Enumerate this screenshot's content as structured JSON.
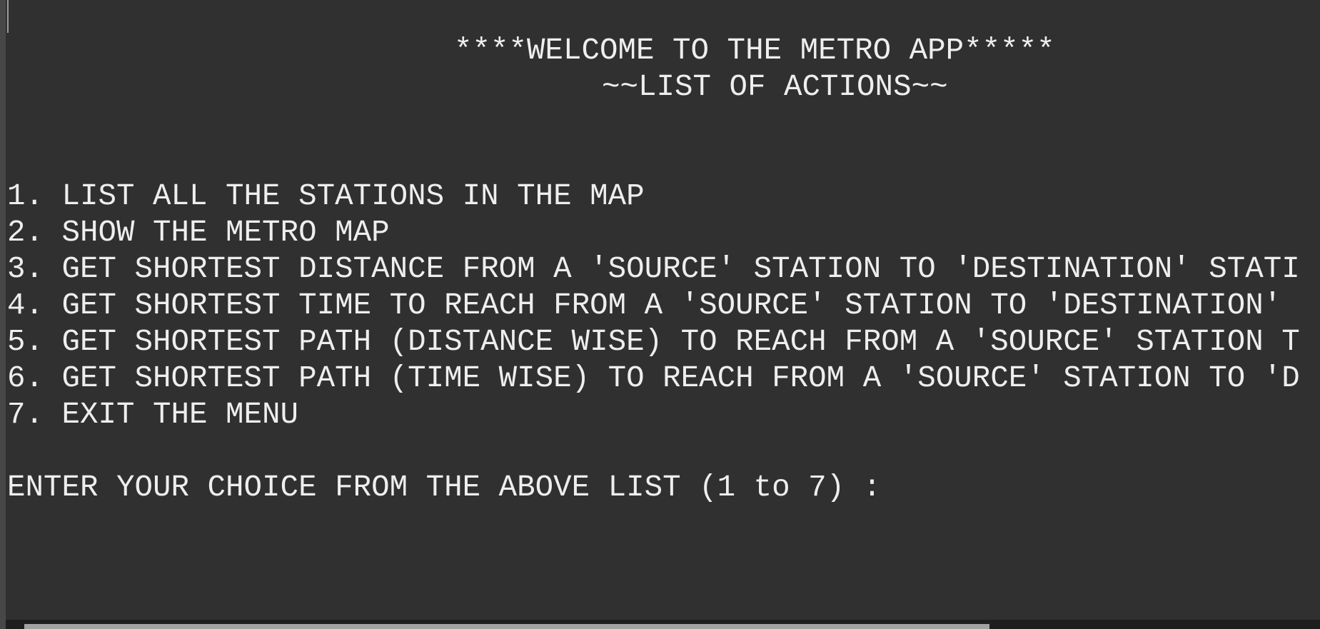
{
  "console": {
    "header": {
      "welcome": "****WELCOME TO THE METRO APP*****",
      "list_title": "~~LIST OF ACTIONS~~"
    },
    "options": [
      "1. LIST ALL THE STATIONS IN THE MAP",
      "2. SHOW THE METRO MAP",
      "3. GET SHORTEST DISTANCE FROM A 'SOURCE' STATION TO 'DESTINATION' STATI",
      "4. GET SHORTEST TIME TO REACH FROM A 'SOURCE' STATION TO 'DESTINATION'",
      "5. GET SHORTEST PATH (DISTANCE WISE) TO REACH FROM A 'SOURCE' STATION T",
      "6. GET SHORTEST PATH (TIME WISE) TO REACH FROM A 'SOURCE' STATION TO 'D",
      "7. EXIT THE MENU"
    ],
    "prompt": "ENTER YOUR CHOICE FROM THE ABOVE LIST (1 to 7) :"
  },
  "colors": {
    "background": "#303030",
    "text": "#eeeeee",
    "scrollbar_thumb": "#a2a2a2"
  }
}
